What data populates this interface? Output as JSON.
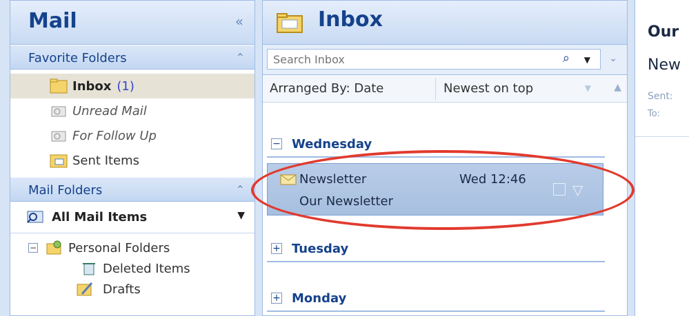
{
  "nav": {
    "title": "Mail",
    "collapse_icon": "«",
    "favorites": {
      "header": "Favorite Folders",
      "items": [
        {
          "label": "Inbox",
          "count": "(1)"
        },
        {
          "label": "Unread Mail"
        },
        {
          "label": "For Follow Up"
        },
        {
          "label": "Sent Items"
        }
      ]
    },
    "mail_folders": {
      "header": "Mail Folders",
      "all_items_label": "All Mail Items",
      "tree": [
        {
          "label": "Personal Folders",
          "expander": "⊟"
        },
        {
          "label": "Deleted Items"
        },
        {
          "label": "Drafts"
        }
      ]
    }
  },
  "inbox": {
    "title": "Inbox",
    "search_placeholder": "Search Inbox",
    "arranged_by": "Arranged By: Date",
    "sort_order": "Newest on top",
    "groups": [
      {
        "label": "Wednesday",
        "expander": "−"
      },
      {
        "label": "Tuesday",
        "expander": "+"
      },
      {
        "label": "Monday",
        "expander": "+"
      }
    ],
    "selected_message": {
      "from": "Newsletter",
      "date": "Wed 12:46",
      "subject": "Our Newsletter"
    }
  },
  "reading_pane": {
    "subject_partial": "Our",
    "from_partial": "New",
    "sent_label": "Sent:",
    "to_label": "To:"
  },
  "colors": {
    "accent": "#15428b",
    "highlight_ring": "#e23a2e",
    "selected_row": "#a7bfe0"
  }
}
